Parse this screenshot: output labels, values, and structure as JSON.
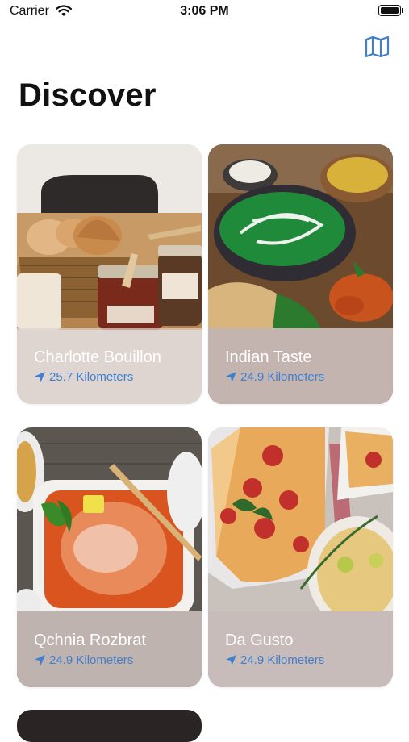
{
  "status_bar": {
    "carrier": "Carrier",
    "time": "3:06 PM"
  },
  "header": {
    "title": "Discover",
    "map_icon": "map-icon"
  },
  "restaurants": [
    {
      "name": "Charlotte Bouillon",
      "distance": "25.7 Kilometers"
    },
    {
      "name": "Indian Taste",
      "distance": "24.9 Kilometers"
    },
    {
      "name": "Qchnia Rozbrat",
      "distance": "24.9 Kilometers"
    },
    {
      "name": "Da Gusto",
      "distance": "24.9 Kilometers"
    }
  ],
  "colors": {
    "accent": "#3f7fd0",
    "footer_overlay": "#e1d4d2"
  }
}
